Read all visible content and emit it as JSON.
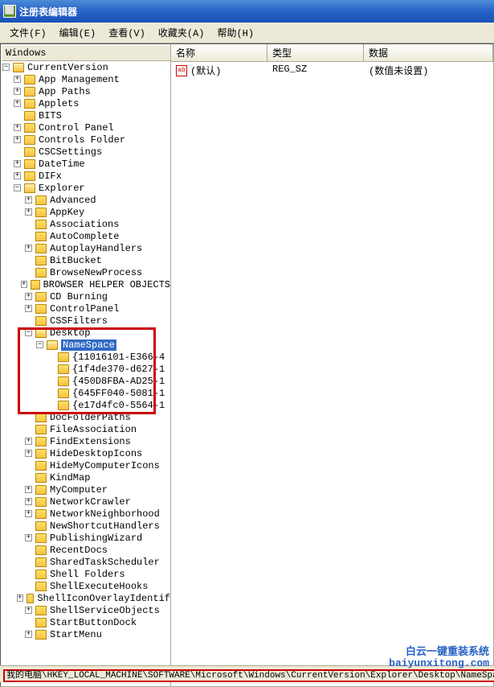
{
  "title": "注册表编辑器",
  "menu": {
    "file": "文件(F)",
    "edit": "编辑(E)",
    "view": "查看(V)",
    "favorites": "收藏夹(A)",
    "help": "帮助(H)"
  },
  "tree_header": "Windows",
  "tree": {
    "root": "CurrentVersion",
    "level1": [
      {
        "label": "App Management",
        "exp": "+"
      },
      {
        "label": "App Paths",
        "exp": "+"
      },
      {
        "label": "Applets",
        "exp": "+"
      },
      {
        "label": "BITS",
        "exp": ""
      },
      {
        "label": "Control Panel",
        "exp": "+"
      },
      {
        "label": "Controls Folder",
        "exp": "+"
      },
      {
        "label": "CSCSettings",
        "exp": ""
      },
      {
        "label": "DateTime",
        "exp": "+"
      },
      {
        "label": "DIFx",
        "exp": "+"
      }
    ],
    "explorer": "Explorer",
    "explorer_children": [
      {
        "label": "Advanced",
        "exp": "+"
      },
      {
        "label": "AppKey",
        "exp": "+"
      },
      {
        "label": "Associations",
        "exp": ""
      },
      {
        "label": "AutoComplete",
        "exp": ""
      },
      {
        "label": "AutoplayHandlers",
        "exp": "+"
      },
      {
        "label": "BitBucket",
        "exp": ""
      },
      {
        "label": "BrowseNewProcess",
        "exp": ""
      },
      {
        "label": "BROWSER HELPER OBJECTS",
        "exp": "+"
      },
      {
        "label": "CD Burning",
        "exp": "+"
      },
      {
        "label": "ControlPanel",
        "exp": "+"
      },
      {
        "label": "CSSFilters",
        "exp": ""
      }
    ],
    "desktop": "Desktop",
    "namespace": "NameSpace",
    "namespace_children": [
      "{11016101-E366-4",
      "{1f4de370-d627-1",
      "{450D8FBA-AD25-1",
      "{645FF040-5081-1",
      "{e17d4fc0-5564-1"
    ],
    "after_desktop": [
      {
        "label": "DocFolderPaths",
        "exp": ""
      },
      {
        "label": "FileAssociation",
        "exp": ""
      },
      {
        "label": "FindExtensions",
        "exp": "+"
      },
      {
        "label": "HideDesktopIcons",
        "exp": "+"
      },
      {
        "label": "HideMyComputerIcons",
        "exp": ""
      },
      {
        "label": "KindMap",
        "exp": ""
      },
      {
        "label": "MyComputer",
        "exp": "+"
      },
      {
        "label": "NetworkCrawler",
        "exp": "+"
      },
      {
        "label": "NetworkNeighborhood",
        "exp": "+"
      },
      {
        "label": "NewShortcutHandlers",
        "exp": ""
      },
      {
        "label": "PublishingWizard",
        "exp": "+"
      },
      {
        "label": "RecentDocs",
        "exp": ""
      },
      {
        "label": "SharedTaskScheduler",
        "exp": ""
      },
      {
        "label": "Shell Folders",
        "exp": ""
      },
      {
        "label": "ShellExecuteHooks",
        "exp": ""
      },
      {
        "label": "ShellIconOverlayIdentif",
        "exp": "+"
      },
      {
        "label": "ShellServiceObjects",
        "exp": "+"
      },
      {
        "label": "StartButtonDock",
        "exp": ""
      },
      {
        "label": "StartMenu",
        "exp": "+"
      }
    ]
  },
  "list": {
    "headers": {
      "name": "名称",
      "type": "类型",
      "data": "数据"
    },
    "row": {
      "name": "(默认)",
      "type": "REG_SZ",
      "data": "(数值未设置)"
    }
  },
  "statusbar": "我的电脑\\HKEY_LOCAL_MACHINE\\SOFTWARE\\Microsoft\\Windows\\CurrentVersion\\Explorer\\Desktop\\NameSpace",
  "watermark": {
    "line1": "白云一键重装系统",
    "line2": "baiyunxitong.com"
  }
}
